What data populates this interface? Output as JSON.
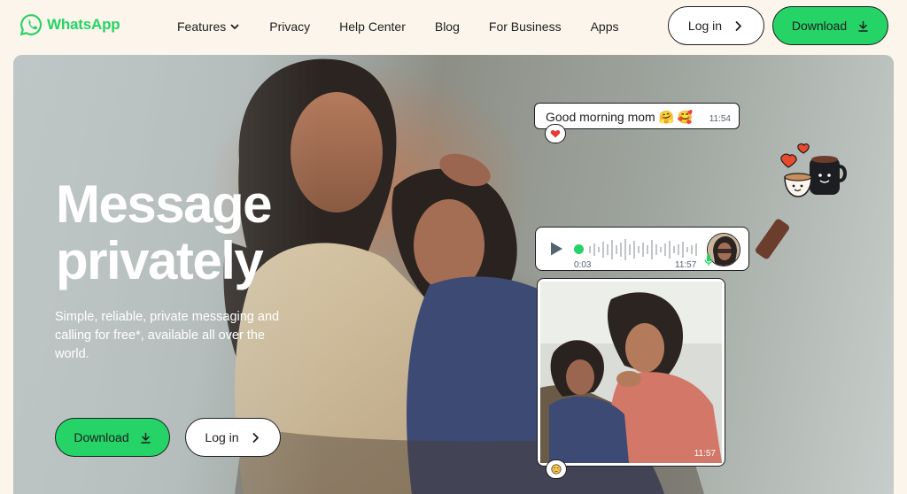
{
  "brand": {
    "name": "WhatsApp",
    "color": "#25d366"
  },
  "nav": {
    "items": [
      {
        "label": "Features",
        "has_dropdown": true
      },
      {
        "label": "Privacy"
      },
      {
        "label": "Help Center"
      },
      {
        "label": "Blog"
      },
      {
        "label": "For Business"
      },
      {
        "label": "Apps"
      }
    ]
  },
  "header": {
    "login_label": "Log in",
    "download_label": "Download"
  },
  "hero": {
    "title": "Message privately",
    "subtitle": "Simple, reliable, private messaging and calling for free*, available all over the world.",
    "download_label": "Download",
    "login_label": "Log in"
  },
  "chat": {
    "message_text": "Good morning mom 🤗 🥰",
    "message_time": "11:54",
    "message_reaction": "heart",
    "voice_duration": "0:03",
    "voice_time": "11:57",
    "photo_time": "11:57",
    "photo_reaction": "blushing-face"
  },
  "icons": {
    "logo": "whatsapp-logo-icon",
    "dropdown": "chevron-down-icon",
    "arrow": "chevron-right-icon",
    "download": "download-arrow-icon",
    "play": "play-icon",
    "mic": "microphone-icon"
  }
}
